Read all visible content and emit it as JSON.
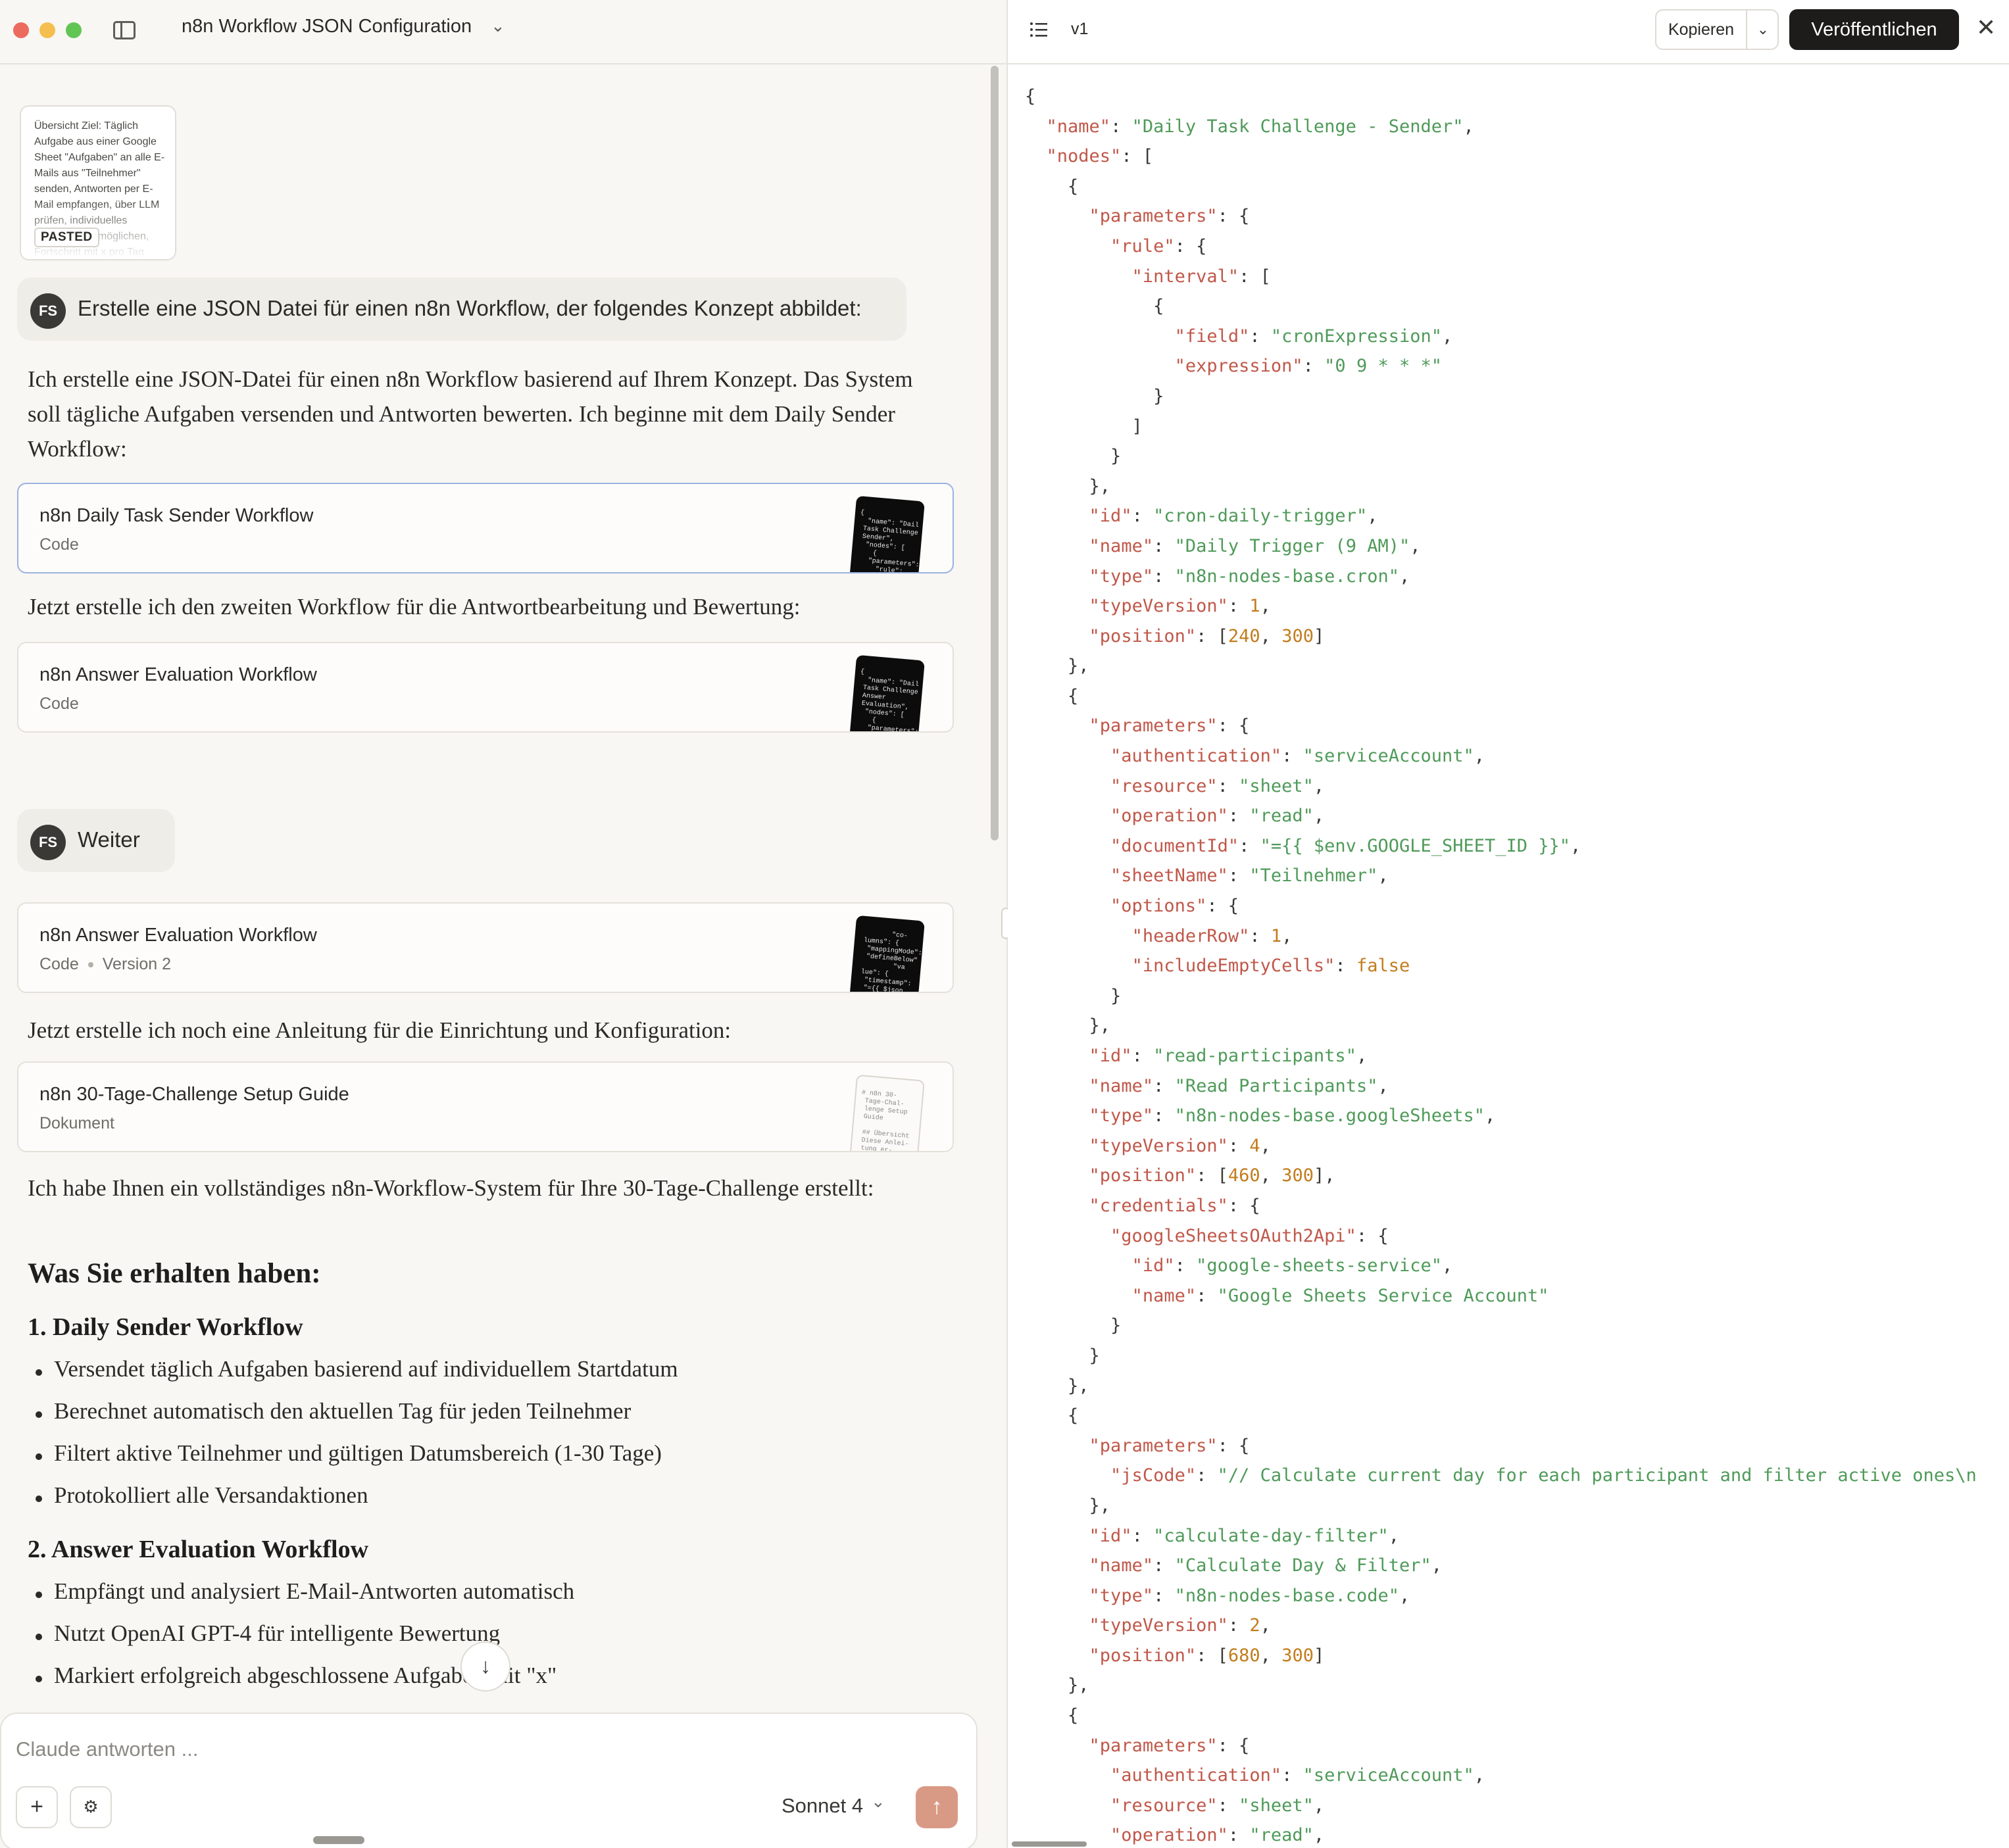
{
  "window": {
    "title": "n8n Workflow JSON Configuration"
  },
  "pasted": {
    "preview": "Übersicht Ziel: Täglich Aufgabe aus einer Google Sheet \"Aufgaben\" an alle E-Mails aus \"Teilnehmer\" senden, Antworten per E-Mail empfangen, über LLM prüfen, individuelles Startdatum ermöglichen, Fortschritt mit x pro Tag",
    "badge": "PASTED"
  },
  "messages": {
    "user1": {
      "avatar": "FS",
      "text": "Erstelle eine JSON Datei für einen n8n Workflow, der folgendes Konzept abbildet:"
    },
    "para1": "Ich erstelle eine JSON-Datei für einen n8n Workflow basierend auf Ihrem Konzept. Das System soll tägliche Aufgaben versenden und Antworten bewerten. Ich beginne mit dem Daily Sender Workflow:",
    "artifact1": {
      "title": "n8n Daily Task Sender Workflow",
      "type": "Code"
    },
    "para2": "Jetzt erstelle ich den zweiten Workflow für die Antwortbearbeitung und Bewertung:",
    "artifact2": {
      "title": "n8n Answer Evaluation Workflow",
      "type": "Code"
    },
    "user2": {
      "avatar": "FS",
      "text": "Weiter"
    },
    "artifact3": {
      "title": "n8n Answer Evaluation Workflow",
      "type": "Code",
      "version": "Version 2"
    },
    "para3": "Jetzt erstelle ich noch eine Anleitung für die Einrichtung und Konfiguration:",
    "artifact4": {
      "title": "n8n 30-Tage-Challenge Setup Guide",
      "type": "Dokument"
    },
    "para4": "Ich habe Ihnen ein vollständiges n8n-Workflow-System für Ihre 30-Tage-Challenge erstellt:",
    "h_received": "Was Sie erhalten haben:",
    "section1": {
      "title": "1. Daily Sender Workflow",
      "bullets": [
        "Versendet täglich Aufgaben basierend auf individuellem Startdatum",
        "Berechnet automatisch den aktuellen Tag für jeden Teilnehmer",
        "Filtert aktive Teilnehmer und gültigen Datumsbereich (1-30 Tage)",
        "Protokolliert alle Versandaktionen"
      ]
    },
    "section2": {
      "title": "2. Answer Evaluation Workflow",
      "bullets": [
        "Empfängt und analysiert E-Mail-Antworten automatisch",
        "Nutzt OpenAI GPT-4 für intelligente Bewertung",
        "Markiert erfolgreich abgeschlossene Aufgaben mit \"x\""
      ]
    }
  },
  "composer": {
    "placeholder": "Claude antworten ...",
    "model": "Sonnet 4"
  },
  "artifact_panel": {
    "version": "v1",
    "copy_label": "Kopieren",
    "publish_label": "Veröffentlichen"
  },
  "code": [
    "{",
    "  \"name\": \"Daily Task Challenge - Sender\",",
    "  \"nodes\": [",
    "    {",
    "      \"parameters\": {",
    "        \"rule\": {",
    "          \"interval\": [",
    "            {",
    "              \"field\": \"cronExpression\",",
    "              \"expression\": \"0 9 * * *\"",
    "            }",
    "          ]",
    "        }",
    "      },",
    "      \"id\": \"cron-daily-trigger\",",
    "      \"name\": \"Daily Trigger (9 AM)\",",
    "      \"type\": \"n8n-nodes-base.cron\",",
    "      \"typeVersion\": 1,",
    "      \"position\": [240, 300]",
    "    },",
    "    {",
    "      \"parameters\": {",
    "        \"authentication\": \"serviceAccount\",",
    "        \"resource\": \"sheet\",",
    "        \"operation\": \"read\",",
    "        \"documentId\": \"={{ $env.GOOGLE_SHEET_ID }}\",",
    "        \"sheetName\": \"Teilnehmer\",",
    "        \"options\": {",
    "          \"headerRow\": 1,",
    "          \"includeEmptyCells\": false",
    "        }",
    "      },",
    "      \"id\": \"read-participants\",",
    "      \"name\": \"Read Participants\",",
    "      \"type\": \"n8n-nodes-base.googleSheets\",",
    "      \"typeVersion\": 4,",
    "      \"position\": [460, 300],",
    "      \"credentials\": {",
    "        \"googleSheetsOAuth2Api\": {",
    "          \"id\": \"google-sheets-service\",",
    "          \"name\": \"Google Sheets Service Account\"",
    "        }",
    "      }",
    "    },",
    "    {",
    "      \"parameters\": {",
    "        \"jsCode\": \"// Calculate current day for each participant and filter active ones\\n",
    "      },",
    "      \"id\": \"calculate-day-filter\",",
    "      \"name\": \"Calculate Day & Filter\",",
    "      \"type\": \"n8n-nodes-base.code\",",
    "      \"typeVersion\": 2,",
    "      \"position\": [680, 300]",
    "    },",
    "    {",
    "      \"parameters\": {",
    "        \"authentication\": \"serviceAccount\",",
    "        \"resource\": \"sheet\",",
    "        \"operation\": \"read\","
  ]
}
